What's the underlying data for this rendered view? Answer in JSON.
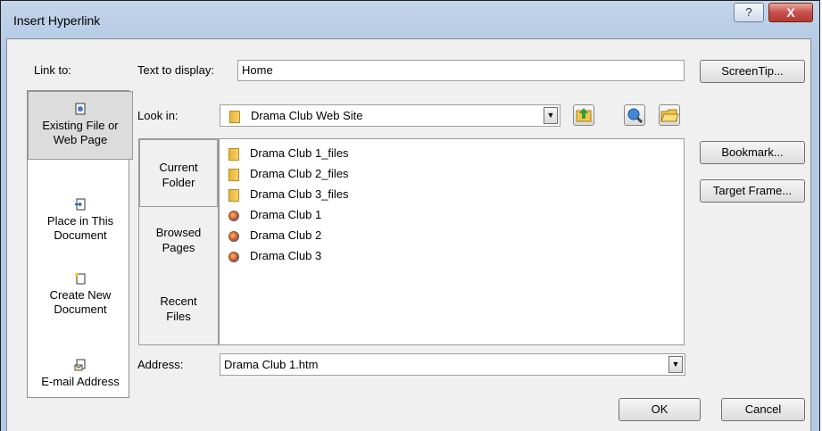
{
  "window": {
    "title": "Insert Hyperlink",
    "help_glyph": "?",
    "close_glyph": "X"
  },
  "link_to": {
    "header": "Link to:",
    "items": [
      {
        "line1": "Existing File or",
        "line2": "Web Page",
        "icon": "web-page-icon",
        "active": true
      },
      {
        "line1": "Place in This",
        "line2": "Document",
        "icon": "place-in-document-icon",
        "active": false
      },
      {
        "line1": "Create New",
        "line2": "Document",
        "icon": "new-document-icon",
        "active": false
      },
      {
        "line1": "E-mail Address",
        "line2": "",
        "icon": "email-icon",
        "active": false
      }
    ]
  },
  "text_to_display": {
    "label": "Text to display:",
    "value": "Home"
  },
  "look_in": {
    "label": "Look in:",
    "value": "Drama Club Web Site"
  },
  "tabs": [
    {
      "line1": "Current",
      "line2": "Folder",
      "active": true
    },
    {
      "line1": "Browsed",
      "line2": "Pages",
      "active": false
    },
    {
      "line1": "Recent",
      "line2": "Files",
      "active": false
    }
  ],
  "files": [
    {
      "name": "Drama Club 1_files",
      "type": "folder"
    },
    {
      "name": "Drama Club 2_files",
      "type": "folder"
    },
    {
      "name": "Drama Club 3_files",
      "type": "folder"
    },
    {
      "name": "Drama Club 1",
      "type": "web-page"
    },
    {
      "name": "Drama Club 2",
      "type": "web-page"
    },
    {
      "name": "Drama Club 3",
      "type": "web-page"
    }
  ],
  "address": {
    "label": "Address:",
    "value": "Drama Club 1.htm"
  },
  "buttons": {
    "screentip": "ScreenTip...",
    "bookmark": "Bookmark...",
    "target_frame": "Target Frame...",
    "ok": "OK",
    "cancel": "Cancel"
  }
}
